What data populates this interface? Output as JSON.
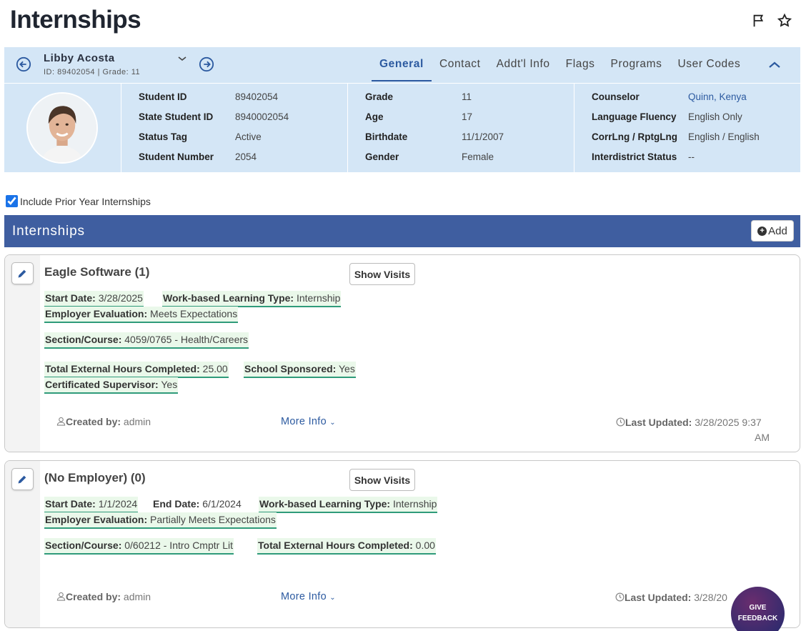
{
  "page": {
    "title": "Internships",
    "flag_icon": "flag-icon",
    "star_icon": "star-icon"
  },
  "student": {
    "name": "Libby Acosta",
    "subline": "ID: 89402054 | Grade: 11",
    "tabs": [
      {
        "label": "General",
        "active": true
      },
      {
        "label": "Contact",
        "active": false
      },
      {
        "label": "Addt'l Info",
        "active": false
      },
      {
        "label": "Flags",
        "active": false
      },
      {
        "label": "Programs",
        "active": false
      },
      {
        "label": "User Codes",
        "active": false
      }
    ]
  },
  "details": {
    "col1": [
      {
        "label": "Student ID",
        "value": "89402054"
      },
      {
        "label": "State Student ID",
        "value": "8940002054"
      },
      {
        "label": "Status Tag",
        "value": "Active"
      },
      {
        "label": "Student Number",
        "value": "2054"
      }
    ],
    "col2": [
      {
        "label": "Grade",
        "value": "11"
      },
      {
        "label": "Age",
        "value": "17"
      },
      {
        "label": "Birthdate",
        "value": "11/1/2007"
      },
      {
        "label": "Gender",
        "value": "Female"
      }
    ],
    "col3": [
      {
        "label": "Counselor",
        "value": "Quinn, Kenya"
      },
      {
        "label": "Language Fluency",
        "value": "English Only"
      },
      {
        "label": "CorrLng / RptgLng",
        "value": "English / English"
      },
      {
        "label": "Interdistrict Status",
        "value": "--"
      }
    ]
  },
  "filter": {
    "prior_year_label": "Include Prior Year Internships",
    "prior_year_checked": true
  },
  "section": {
    "title": "Internships",
    "add_label": "Add"
  },
  "cards": [
    {
      "title": "Eagle Software (1)",
      "show_visits": "Show Visits",
      "start_date_label": "Start Date:",
      "start_date": "3/28/2025",
      "wbl_label": "Work-based Learning Type:",
      "wbl": "Internship",
      "eval_label": "Employer Evaluation:",
      "eval": "Meets Expectations",
      "section_label": "Section/Course:",
      "section": "4059/0765 - Health/Careers",
      "hours_label": "Total External Hours Completed:",
      "hours": "25.00",
      "sponsored_label": "School Sponsored:",
      "sponsored": "Yes",
      "supervisor_label": "Certificated Supervisor:",
      "supervisor": "Yes",
      "created_label": "Created by:",
      "created_by": "admin",
      "more_info": "More Info",
      "updated_label": "Last Updated:",
      "updated_line1": "3/28/2025 9:37",
      "updated_line2": "AM"
    },
    {
      "title": "(No Employer) (0)",
      "show_visits": "Show Visits",
      "start_date_label": "Start Date:",
      "start_date": "1/1/2024",
      "end_date_label": "End Date:",
      "end_date": "6/1/2024",
      "wbl_label": "Work-based Learning Type:",
      "wbl": "Internship",
      "eval_label": "Employer Evaluation:",
      "eval": "Partially Meets Expectations",
      "section_label": "Section/Course:",
      "section": "0/60212 - Intro Cmptr Lit",
      "hours_label": "Total External Hours Completed:",
      "hours": "0.00",
      "created_label": "Created by:",
      "created_by": "admin",
      "more_info": "More Info",
      "updated_label": "Last Updated:",
      "updated_line1": "3/28/20"
    }
  ],
  "feedback": {
    "line1": "GIVE",
    "line2": "FEEDBACK"
  }
}
